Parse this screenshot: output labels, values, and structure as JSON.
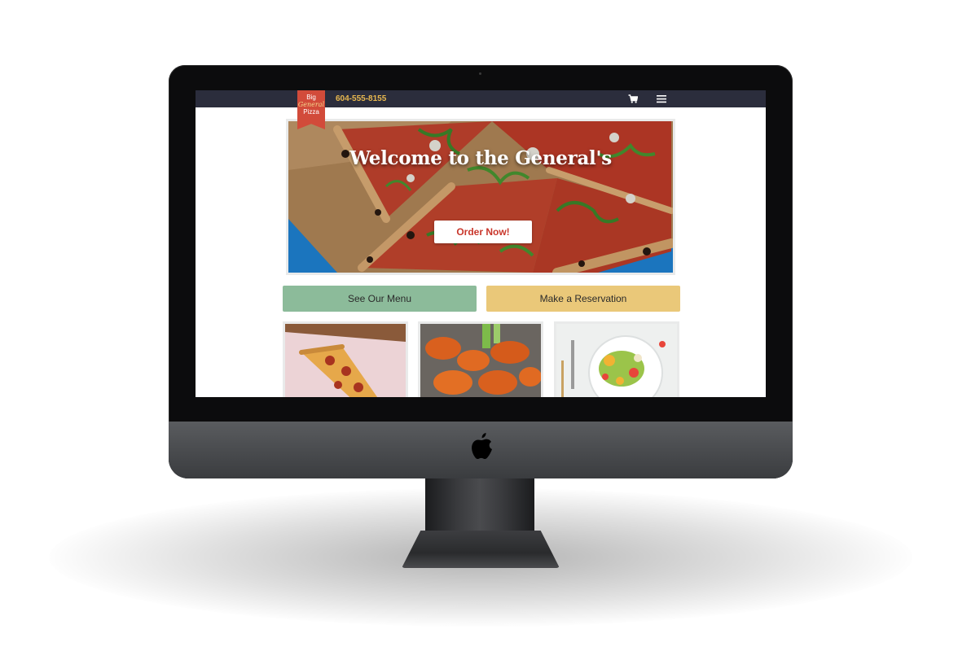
{
  "brand": {
    "logo_line1": "Big",
    "logo_line2": "General",
    "logo_line3": "Pizza",
    "phone": "604-555-8155"
  },
  "nav": {
    "cart_icon": "cart-icon",
    "menu_icon": "hamburger-menu-icon"
  },
  "hero": {
    "title": "Welcome to the General's",
    "cta_label": "Order Now!"
  },
  "actions": {
    "menu_label": "See Our Menu",
    "reservation_label": "Make a Reservation"
  },
  "gallery": {
    "items": [
      "pizza-slice-photo",
      "chicken-wings-photo",
      "salad-photo"
    ]
  },
  "colors": {
    "navbar": "#2b2d3c",
    "logo_red": "#d24b3a",
    "phone_gold": "#e8b84f",
    "order_text": "#c9362b",
    "menu_button": "#8cbb9a",
    "reservation_button": "#eac879"
  }
}
